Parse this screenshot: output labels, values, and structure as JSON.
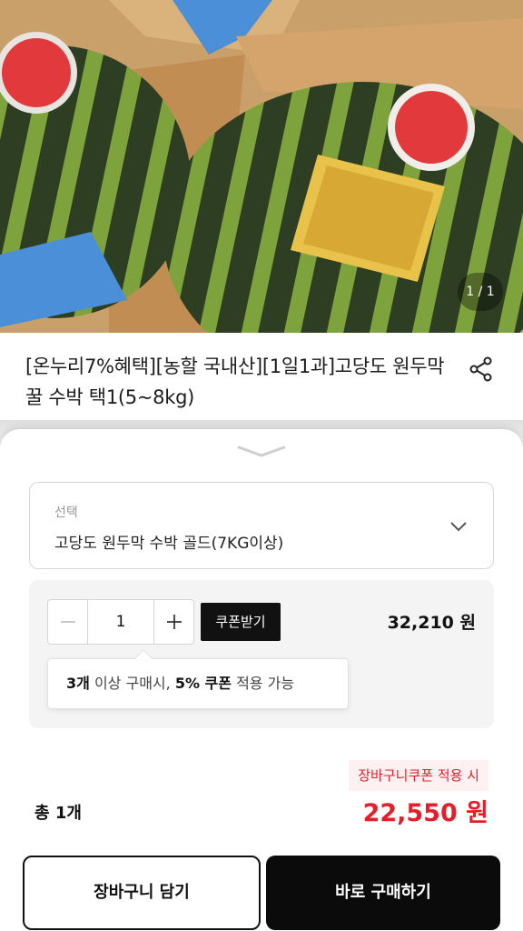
{
  "product": {
    "image_counter": "1 / 1",
    "title": "[온누리7%혜택][농할 국내산][1일1과]고당도 원두막 꿀 수박 택1(5~8kg)"
  },
  "option": {
    "label": "선택",
    "selected": "고당도 원두막 수박 골드(7KG이상)",
    "quantity": "1",
    "coupon_button": "쿠폰받기",
    "price": "32,210 원"
  },
  "tip": {
    "qty": "3개",
    "text1": " 이상 구매시, ",
    "rate": "5% 쿠폰",
    "text2": " 적용 가능"
  },
  "summary": {
    "cart_coupon_badge": "장바구니쿠폰 적용 시",
    "total_count": "총 1개",
    "total_price": "22,550 원"
  },
  "actions": {
    "add_to_cart": "장바구니 담기",
    "buy_now": "바로 구매하기"
  },
  "icons": [
    "share-icon",
    "handle-chevron-icon",
    "chevron-down-icon",
    "minus-icon",
    "plus-icon"
  ],
  "colors": {
    "accent_red": "#e51f2a",
    "primary_black": "#0b0b0b"
  }
}
